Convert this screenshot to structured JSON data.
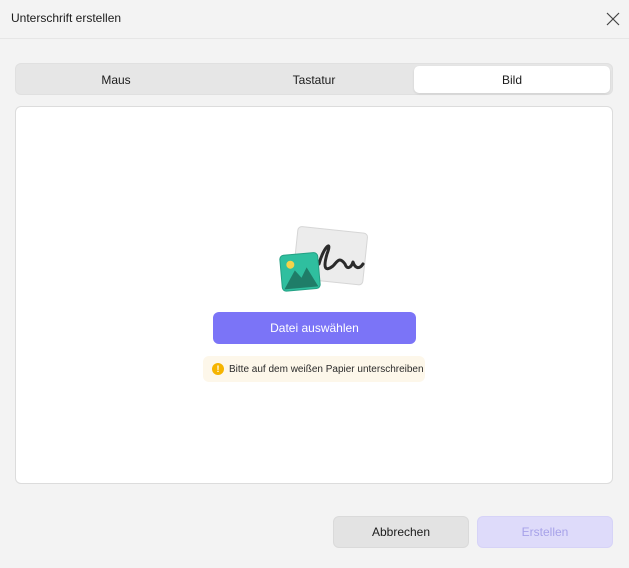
{
  "dialog": {
    "title": "Unterschrift erstellen"
  },
  "tabs": [
    {
      "label": "Maus",
      "active": false
    },
    {
      "label": "Tastatur",
      "active": false
    },
    {
      "label": "Bild",
      "active": true
    }
  ],
  "panel": {
    "illustration_icon": "image-signature-illustration",
    "select_button_label": "Datei auswählen",
    "hint_text": "Bitte auf dem weißen Papier unterschreiben",
    "hint_icon": "warning-icon"
  },
  "footer": {
    "cancel_label": "Abbrechen",
    "create_label": "Erstellen",
    "create_enabled": false
  },
  "colors": {
    "accent": "#7b74f7",
    "accent_disabled": "#dedbfa",
    "hint_background": "#fdf7ea",
    "hint_icon": "#f5b400"
  }
}
